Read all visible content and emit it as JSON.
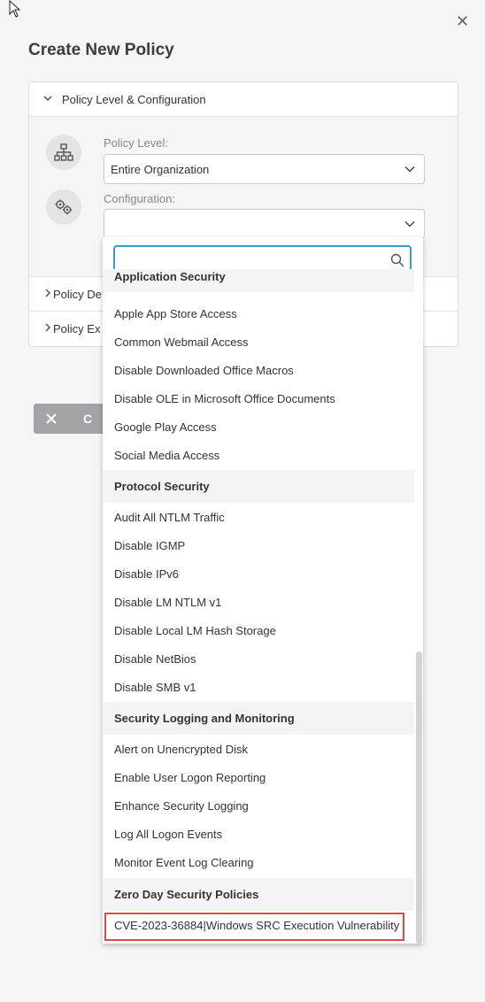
{
  "dialog": {
    "title": "Create New Policy",
    "close_glyph": "✕"
  },
  "sections": {
    "level_config": {
      "label": "Policy Level & Configuration",
      "policy_level_label": "Policy Level:",
      "policy_level_value": "Entire Organization",
      "configuration_label": "Configuration:",
      "configuration_value": ""
    },
    "collapsed_1": "Policy De",
    "collapsed_2": "Policy Ex"
  },
  "cancel_button": {
    "icon": "close-icon",
    "label": "C"
  },
  "dropdown": {
    "search_placeholder": "",
    "groups": [
      {
        "name": "Application Security",
        "items": [
          "Apple App Store Access",
          "Common Webmail Access",
          "Disable Downloaded Office Macros",
          "Disable OLE in Microsoft Office Documents",
          "Google Play Access",
          "Social Media Access"
        ]
      },
      {
        "name": "Protocol Security",
        "items": [
          "Audit All NTLM Traffic",
          "Disable IGMP",
          "Disable IPv6",
          "Disable LM NTLM v1",
          "Disable Local LM Hash Storage",
          "Disable NetBios",
          "Disable SMB v1"
        ]
      },
      {
        "name": "Security Logging and Monitoring",
        "items": [
          "Alert on Unencrypted Disk",
          "Enable User Logon Reporting",
          "Enhance Security Logging",
          "Log All Logon Events",
          "Monitor Event Log Clearing"
        ]
      },
      {
        "name": "Zero Day Security Policies",
        "items": [
          "CVE-2023-36884|Windows SRC Execution Vulnerability"
        ]
      }
    ]
  },
  "colors": {
    "focus_border": "#3b99d8",
    "highlight_border": "#e04848",
    "cancel_bg": "#a3a3a8"
  }
}
